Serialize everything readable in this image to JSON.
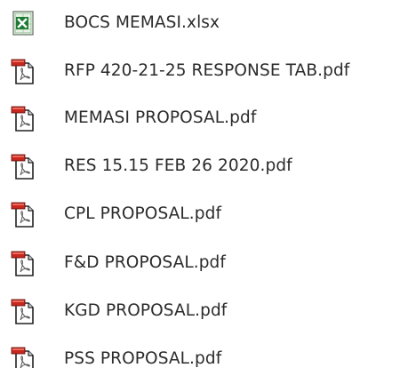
{
  "files": [
    {
      "name": "BOCS MEMASI.xlsx",
      "icon": "excel-file-icon"
    },
    {
      "name": "RFP 420-21-25 RESPONSE TAB.pdf",
      "icon": "pdf-file-icon"
    },
    {
      "name": "MEMASI PROPOSAL.pdf",
      "icon": "pdf-file-icon"
    },
    {
      "name": "RES 15.15 FEB 26 2020.pdf",
      "icon": "pdf-file-icon"
    },
    {
      "name": "CPL PROPOSAL.pdf",
      "icon": "pdf-file-icon"
    },
    {
      "name": "F&D PROPOSAL.pdf",
      "icon": "pdf-file-icon"
    },
    {
      "name": "KGD PROPOSAL.pdf",
      "icon": "pdf-file-icon"
    },
    {
      "name": "PSS PROPOSAL.pdf",
      "icon": "pdf-file-icon"
    }
  ],
  "colors": {
    "text": "#2b2b2b",
    "excel_green": "#1e7b34",
    "pdf_red": "#c8281e"
  }
}
